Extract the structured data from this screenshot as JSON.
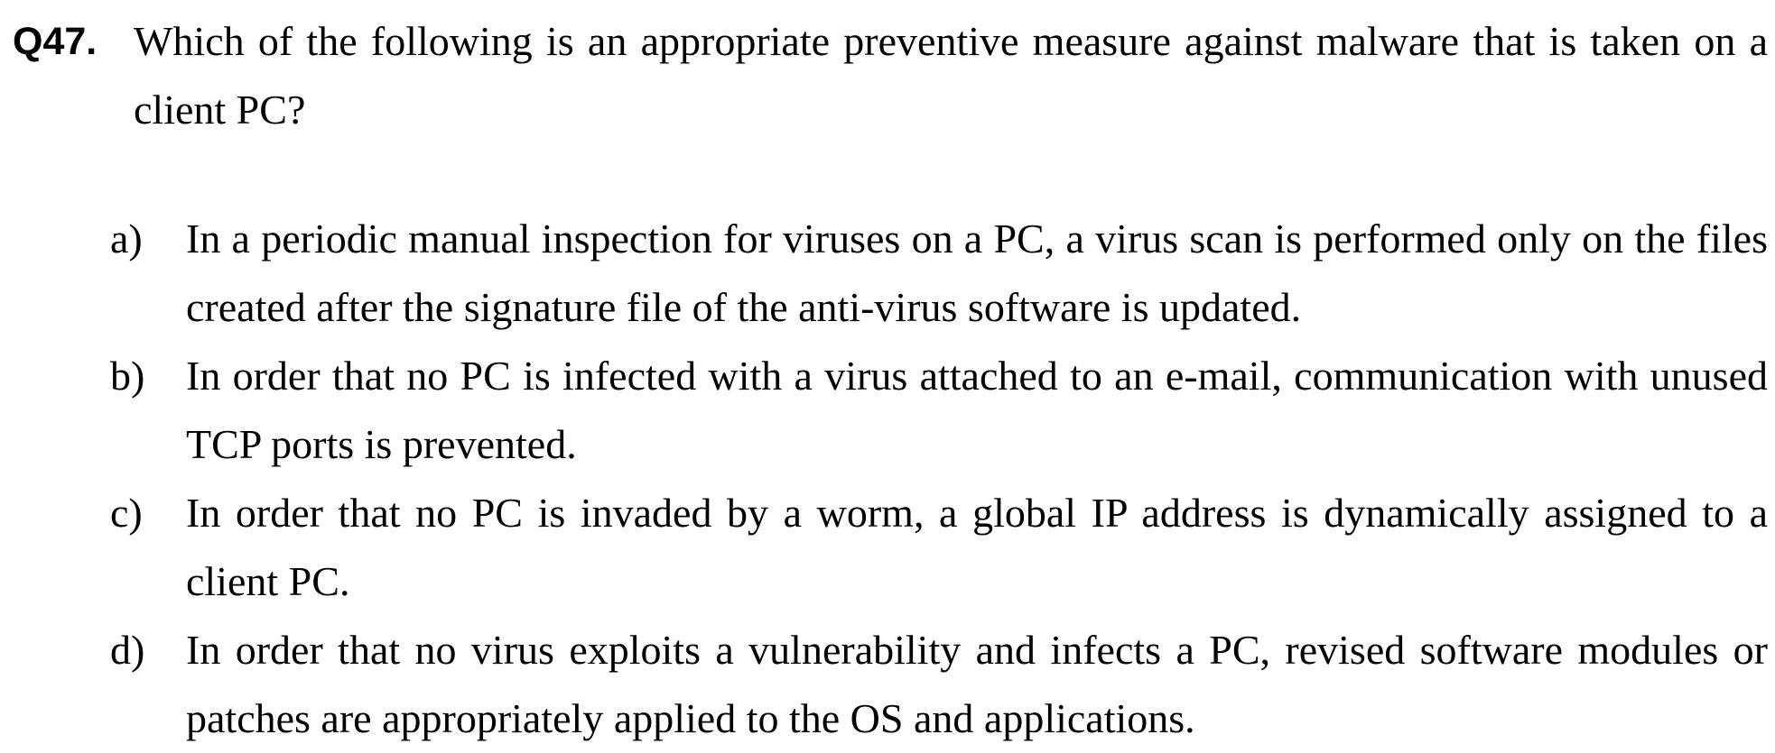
{
  "question": {
    "number": "Q47.",
    "text": "Which of the following is an appropriate preventive measure against malware that is taken on a client PC?"
  },
  "options": [
    {
      "label": "a)",
      "text": "In a periodic manual inspection for viruses on a PC, a virus scan is performed only on the files created after the signature file of the anti-virus software is updated."
    },
    {
      "label": "b)",
      "text": "In order that no PC is infected with a virus attached to an e-mail, communication with unused TCP ports is prevented."
    },
    {
      "label": "c)",
      "text": "In order that no PC is invaded by a worm, a global IP address is dynamically assigned to a client PC."
    },
    {
      "label": "d)",
      "text": "In order that no virus exploits a vulnerability and infects a PC, revised software modules or patches are appropriately applied to the OS and applications."
    }
  ]
}
